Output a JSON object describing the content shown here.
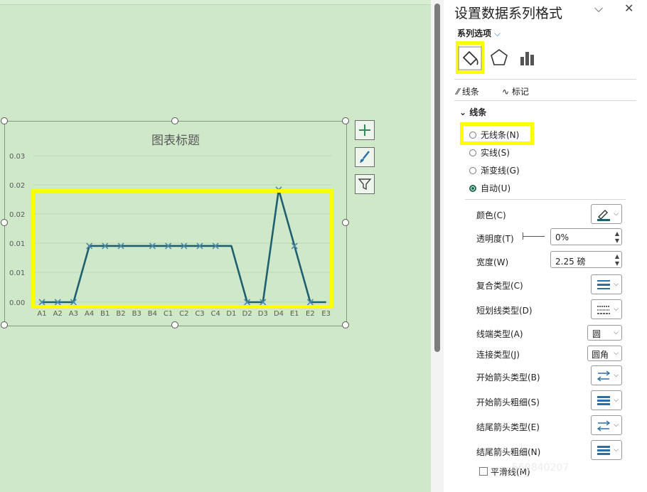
{
  "chart": {
    "title": "图表标题",
    "y_ticks": [
      "0.03",
      "0.02",
      "0.02",
      "0.01",
      "0.01",
      "0.00"
    ],
    "side_buttons": [
      "chart-elements-button",
      "chart-styles-button",
      "chart-filters-button"
    ]
  },
  "chart_data": {
    "type": "line",
    "title": "图表标题",
    "categories": [
      "A1",
      "A2",
      "A3",
      "A4",
      "B1",
      "B2",
      "B3",
      "B4",
      "C1",
      "C2",
      "C3",
      "C4",
      "D1",
      "D2",
      "D3",
      "D4",
      "E1",
      "E2",
      "E3"
    ],
    "series": [
      {
        "values": [
          0,
          0,
          0,
          0.01,
          0.01,
          0.01,
          0.01,
          0.01,
          0.01,
          0.01,
          0.01,
          0.01,
          0.01,
          0,
          0,
          0.02,
          0.01,
          0,
          0
        ]
      }
    ],
    "marker_categories": [
      "A1",
      "A2",
      "A3",
      "A4",
      "B1",
      "B2",
      "B4",
      "C1",
      "C2",
      "C3",
      "C4",
      "D2",
      "D3",
      "D4",
      "E1",
      "E2"
    ],
    "y_tick_labels": [
      "0.03",
      "0.02",
      "0.02",
      "0.01",
      "0.01",
      "0.00"
    ],
    "ylim": [
      0,
      0.025
    ],
    "colors": {
      "line": "#1f5f6e",
      "marker": "#4a8aa8",
      "highlight": "#ffff00",
      "background": "#cfe8c9"
    }
  },
  "panel": {
    "title": "设置数据系列格式",
    "series_options": "系列选项",
    "subtabs": {
      "line": "线条",
      "marker": "标记"
    },
    "section": "线条",
    "radios": [
      {
        "label": "无线条(N)",
        "selected": false
      },
      {
        "label": "实线(S)",
        "selected": false
      },
      {
        "label": "渐变线(G)",
        "selected": false
      },
      {
        "label": "自动(U)",
        "selected": true
      }
    ],
    "props": {
      "color": "颜色(C)",
      "transparency": "透明度(T)",
      "transparency_value": "0%",
      "width": "宽度(W)",
      "width_value": "2.25 磅",
      "compound": "复合类型(C)",
      "dash": "短划线类型(D)",
      "cap": "线端类型(A)",
      "cap_value": "圆",
      "join": "连接类型(J)",
      "join_value": "圆角",
      "begin_arrow_type": "开始箭头类型(B)",
      "begin_arrow_size": "开始箭头粗细(S)",
      "end_arrow_type": "结尾箭头类型(E)",
      "end_arrow_size": "结尾箭头粗细(N)",
      "smooth": "平滑线(M)"
    },
    "watermark": "560840207"
  }
}
